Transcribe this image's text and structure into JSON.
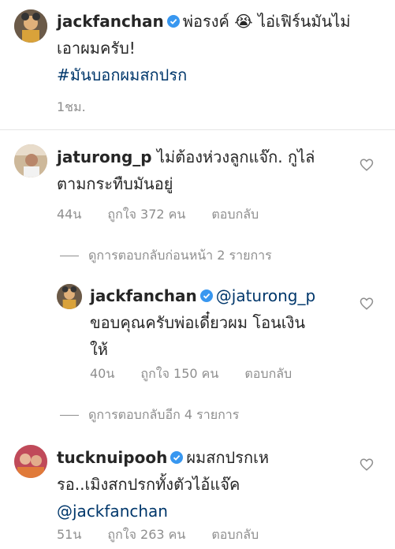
{
  "post": {
    "username": "jackfanchan",
    "caption": "พ่อรงค์ 😭 ไอ่เฟิร์นมันไม่เอาผมครับ!",
    "caption_line1": "พ่อรงค์ 😭 ไอ่เฟิร์นมันไม่",
    "caption_line2": "เอาผมครับ!",
    "hashtag": "#มันบอกผมสกปรก",
    "time": "1ชม."
  },
  "comments": [
    {
      "username": "jaturong_p",
      "text_line1": "ไม่ต้องห่วงลูกแจ๊ก. กูไล่",
      "text_line2": "ตามกระทืบมันอยู่",
      "time": "44น",
      "likes": "ถูกใจ 372 คน",
      "reply_label": "ตอบกลับ"
    },
    {
      "username": "jackfanchan",
      "mention": "@jaturong_p",
      "text_line1": "ขอบคุณครับพ่อเดี๋ยวผม โอนเงิน",
      "text_line2": "ให้",
      "time": "40น",
      "likes": "ถูกใจ 150 คน",
      "reply_label": "ตอบกลับ"
    },
    {
      "username": "tucknuipooh",
      "text_line1": "ผมสกปรกเห",
      "text_line2": "รอ..เมิงสกปรกทั้งตัวไอ้แจ๊ค",
      "mention": "@jackfanchan",
      "time": "51น",
      "likes": "ถูกใจ 263 คน",
      "reply_label": "ตอบกลับ"
    }
  ],
  "view_replies_prev": "ดูการตอบกลับก่อนหน้า 2 รายการ",
  "view_replies_more": "ดูการตอบกลับอีก 4 รายการ",
  "colors": {
    "verified": "#3897f0",
    "link": "#00376b",
    "meta": "#8e8e8e"
  },
  "icons": {
    "verified": "verified-badge-icon",
    "heart": "heart-outline-icon"
  }
}
